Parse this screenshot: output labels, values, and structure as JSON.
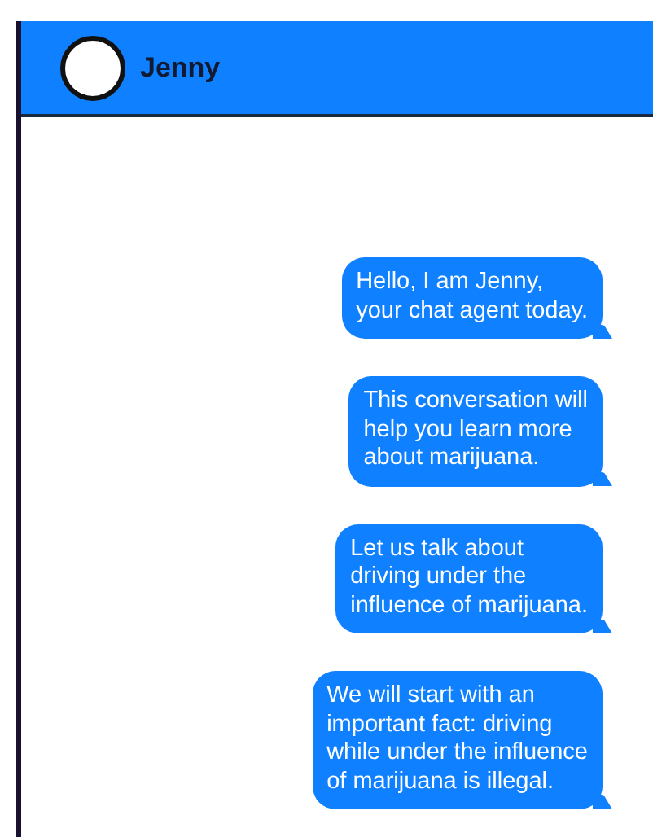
{
  "header": {
    "name": "Jenny"
  },
  "messages": [
    {
      "text": "Hello, I am Jenny,\nyour chat agent today."
    },
    {
      "text": "This conversation will\nhelp you learn more\nabout marijuana."
    },
    {
      "text": "Let us talk about\ndriving under the\ninfluence of marijuana."
    },
    {
      "text": "We will start with an\nimportant fact: driving\nwhile under the influence\nof marijuana is illegal."
    }
  ]
}
